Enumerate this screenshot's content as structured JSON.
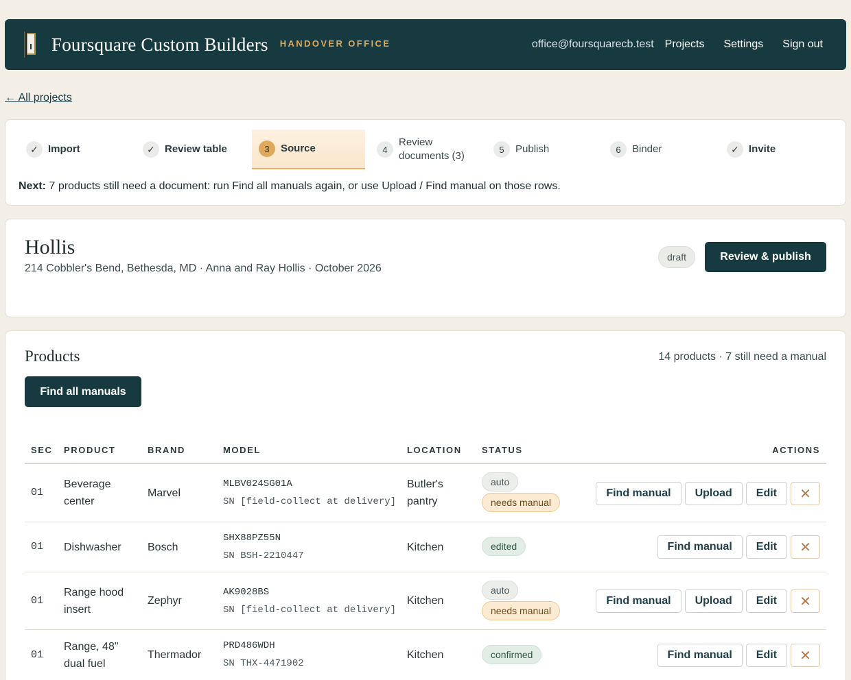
{
  "header": {
    "brand": "Foursquare Custom Builders",
    "tagline": "HANDOVER OFFICE",
    "email": "office@foursquarecb.test",
    "nav": [
      "Projects",
      "Settings",
      "Sign out"
    ]
  },
  "back_link": "← All projects",
  "steps": [
    {
      "marker": "✓",
      "label": "Import",
      "state": "done"
    },
    {
      "marker": "✓",
      "label": "Review table",
      "state": "done"
    },
    {
      "marker": "3",
      "label": "Source",
      "state": "active"
    },
    {
      "marker": "4",
      "label": "Review",
      "label2": "documents (3)",
      "state": "pending"
    },
    {
      "marker": "5",
      "label": "Publish",
      "state": "pending"
    },
    {
      "marker": "6",
      "label": "Binder",
      "state": "pending"
    },
    {
      "marker": "✓",
      "label": "Invite",
      "state": "done"
    }
  ],
  "next": {
    "prefix": "Next:",
    "text": "7 products still need a document: run Find all manuals again, or use Upload / Find manual on those rows."
  },
  "project": {
    "name": "Hollis",
    "subtitle": "214 Cobbler's Bend, Bethesda, MD · Anna and Ray Hollis · October 2026",
    "status": "draft",
    "publish_label": "Review & publish"
  },
  "products": {
    "title": "Products",
    "summary": "14 products · 7 still need a manual",
    "find_all_label": "Find all manuals",
    "columns": {
      "sec": "SEC",
      "product": "PRODUCT",
      "brand": "BRAND",
      "model": "MODEL",
      "location": "LOCATION",
      "status": "STATUS",
      "actions": "ACTIONS"
    },
    "action_labels": {
      "find": "Find manual",
      "upload": "Upload",
      "edit": "Edit",
      "remove": "✕"
    },
    "rows": [
      {
        "sec": "01",
        "product1": "Beverage",
        "product2": "center",
        "brand": "Marvel",
        "model": "MLBV024SG01A",
        "serial": "SN [field-collect at delivery]",
        "location1": "Butler's",
        "location2": "pantry",
        "badges": [
          "auto",
          "needs manual"
        ]
      },
      {
        "sec": "01",
        "product1": "Dishwasher",
        "product2": "",
        "brand": "Bosch",
        "model": "SHX88PZ55N",
        "serial": "SN BSH-2210447",
        "location1": "Kitchen",
        "location2": "",
        "badges": [
          "edited"
        ]
      },
      {
        "sec": "01",
        "product1": "Range hood",
        "product2": "insert",
        "brand": "Zephyr",
        "model": "AK9028BS",
        "serial": "SN [field-collect at delivery]",
        "location1": "Kitchen",
        "location2": "",
        "badges": [
          "auto",
          "needs manual"
        ]
      },
      {
        "sec": "01",
        "product1": "Range, 48\"",
        "product2": "dual fuel",
        "brand": "Thermador",
        "model": "PRD486WDH",
        "serial": "SN THX-4471902",
        "location1": "Kitchen",
        "location2": "",
        "badges": [
          "confirmed"
        ]
      }
    ]
  }
}
